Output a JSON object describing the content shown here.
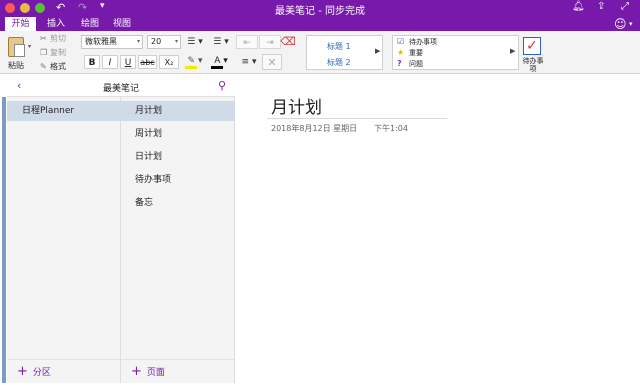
{
  "window": {
    "title": "最美笔记 - 同步完成"
  },
  "tabs": [
    {
      "label": "开始",
      "active": true
    },
    {
      "label": "插入",
      "active": false
    },
    {
      "label": "绘图",
      "active": false
    },
    {
      "label": "视图",
      "active": false
    }
  ],
  "ribbon": {
    "paste_label": "粘贴",
    "clipboard": [
      {
        "label": "剪切",
        "enabled": false
      },
      {
        "label": "复制",
        "enabled": false
      },
      {
        "label": "格式",
        "enabled": true
      }
    ],
    "font": {
      "name": "微软雅黑",
      "size": "20"
    },
    "format_buttons": {
      "bold": "B",
      "italic": "I",
      "underline": "U",
      "strike": "abc",
      "subscript": "X₂"
    },
    "styles": [
      "标题 1",
      "标题 2"
    ],
    "tags": [
      "待办事项",
      "重要",
      "问题"
    ],
    "todo_label": "待办事项"
  },
  "notebook": {
    "title": "最美笔记"
  },
  "sections": [
    {
      "label": "日程Planner",
      "active": true
    }
  ],
  "pages": [
    {
      "label": "月计划",
      "active": true
    },
    {
      "label": "周计划",
      "active": false
    },
    {
      "label": "日计划",
      "active": false
    },
    {
      "label": "待办事项",
      "active": false
    },
    {
      "label": "备忘",
      "active": false
    }
  ],
  "footer": {
    "add_section": "分区",
    "add_page": "页面"
  },
  "page": {
    "title": "月计划",
    "date": "2018年8月12日 星期日",
    "time": "下午1:04"
  },
  "colors": {
    "accent": "#7719aa",
    "selection": "#d0dbe8"
  }
}
